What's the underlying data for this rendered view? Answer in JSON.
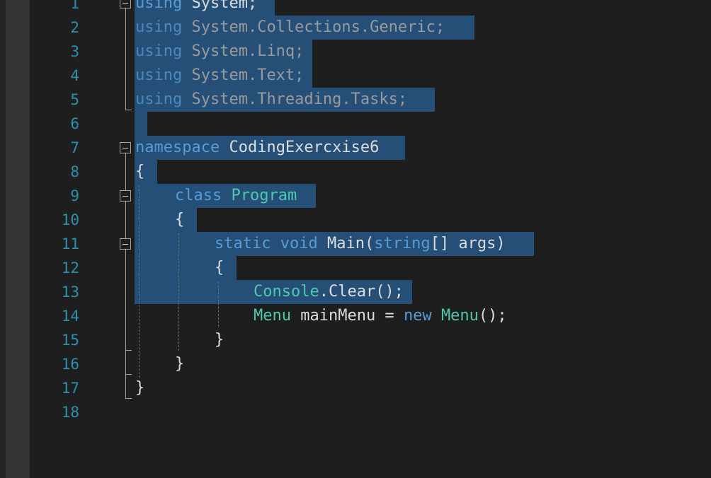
{
  "editor": {
    "line_numbers": [
      "1",
      "2",
      "3",
      "4",
      "5",
      "6",
      "7",
      "8",
      "9",
      "10",
      "11",
      "12",
      "13",
      "14",
      "15",
      "16",
      "17",
      "18"
    ],
    "lines": {
      "l1": {
        "kw": "using",
        "rest": " System;"
      },
      "l2": {
        "kw": "using",
        "rest": " System.Collections.Generic;"
      },
      "l3": {
        "kw": "using",
        "rest": " System.Linq;"
      },
      "l4": {
        "kw": "using",
        "rest": " System.Text;"
      },
      "l5": {
        "kw": "using",
        "rest": " System.Threading.Tasks;"
      },
      "l7": {
        "kw": "namespace",
        "rest": " CodingExercxise6"
      },
      "l8": {
        "text": "{"
      },
      "l9": {
        "kw": "class",
        "type": "Program"
      },
      "l10": {
        "text": "{"
      },
      "l11": {
        "kw1": "static",
        "kw2": "void",
        "name": "Main(",
        "kw3": "string",
        "rest": "[] args)"
      },
      "l12": {
        "text": "{"
      },
      "l13": {
        "type": "Console",
        "rest": ".Clear();"
      },
      "l14": {
        "type1": "Menu",
        "mid": " mainMenu = ",
        "kw": "new",
        "type2": "Menu",
        "rest": "();"
      },
      "l15": {
        "text": "}"
      },
      "l16": {
        "text": "}"
      },
      "l17": {
        "text": "}"
      }
    },
    "colors": {
      "background": "#1e1e1e",
      "selection": "#264f78",
      "keyword": "#569cd6",
      "type": "#4ec9b0",
      "plain": "#dcdcdc",
      "line_number": "#2b91af"
    }
  }
}
